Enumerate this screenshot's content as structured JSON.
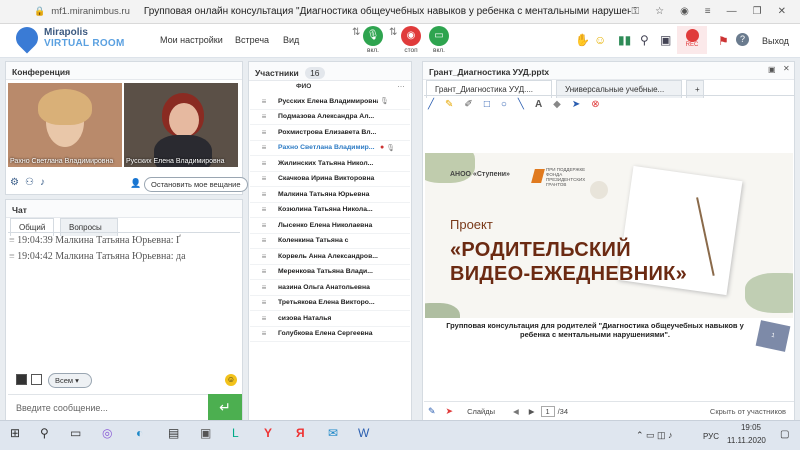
{
  "browser": {
    "url": "mf1.miranimbus.ru",
    "tab_title": "Групповая онлайн консультация \"Диагностика общеучебных навыков у ребенка с ментальными нарушения...",
    "icons": [
      "lock-icon",
      "key-icon",
      "star-icon",
      "profile-icon",
      "menu-icon",
      "minimize-icon",
      "restore-icon",
      "close-icon"
    ]
  },
  "header": {
    "logo_line1": "Mirapolis",
    "logo_line2": "VIRTUAL ROOM",
    "menu": [
      "Мои настройки",
      "Встреча",
      "Вид"
    ],
    "controls": [
      {
        "label": "вкл.",
        "color": "#2ea44f",
        "icon": "microphone-icon"
      },
      {
        "label": "стоп",
        "color": "#e03b3b",
        "icon": "camera-icon"
      },
      {
        "label": "вкл.",
        "color": "#2ea44f",
        "icon": "screen-icon"
      }
    ],
    "rec_label": "REC",
    "exit_label": "Выход"
  },
  "conference": {
    "title": "Конференция",
    "video1_name": "Рахно Светлана  Владимировна",
    "video2_name": "Русских Елена Владимировна",
    "stop_button": "Остановить мое вещание"
  },
  "chat": {
    "title": "Чат",
    "tabs": [
      "Общий",
      "Вопросы"
    ],
    "messages": [
      {
        "time": "19:04:39",
        "author": "Малкина Татьяна  Юрьевна:",
        "text": "Ґ"
      },
      {
        "time": "19:04:42",
        "author": "Малкина Татьяна  Юрьевна:",
        "text": "да"
      }
    ],
    "recipient": "Всем",
    "input_placeholder": "Введите сообщение..."
  },
  "participants": {
    "title": "Участники",
    "count": "16",
    "column": "ФИО",
    "rows": [
      "Русских Елена Владимировна",
      "Подмазова Александра Ал...",
      "Рохмистрова  Елизавета Вл...",
      "Рахно Светлана  Владимир...",
      "Жилинских  Татьяна  Никол...",
      "Скачкова Ирина Викторовна",
      "Малкина Татьяна  Юрьевна",
      "Козюлина  Татьяна Никола...",
      "Лысенко Елена Николаевна",
      "Коленкина  Татьяна  с",
      "Корвель Анна  Александров...",
      "Меренкова  Татьяна  Влади...",
      "назина  Ольга Анатольевна",
      "Третьякова  Елена Викторо...",
      "сизова  Наталья",
      "Голубкова  Елена Сергеевна"
    ]
  },
  "presentation": {
    "title": "Грант_Диагностика УУД.pptx",
    "tabs": [
      "Грант_Диагностика УУД....",
      "Универсальные учебные..."
    ],
    "slide": {
      "org": "АНОО «Ступени»",
      "support": "ПРИ ПОДДЕРЖКЕ\nФОНДА\nПРЕЗИДЕНТСКИХ\nГРАНТОВ",
      "project": "Проект",
      "headline1": "«РОДИТЕЛЬСКИЙ",
      "headline2": "ВИДЕО-ЕЖЕДНЕВНИК»",
      "caption": "Групповая консультация для родителей \"Диагностика общеучебных навыков у ребенка с ментальными нарушениями\".",
      "page_badge": "1"
    },
    "footer": {
      "slides_label": "Слайды",
      "current": "1",
      "total": "/34",
      "hidden": "Скрыть от участников"
    }
  },
  "taskbar": {
    "time": "19:05",
    "date": "11.11.2020",
    "lang": "РУС"
  }
}
